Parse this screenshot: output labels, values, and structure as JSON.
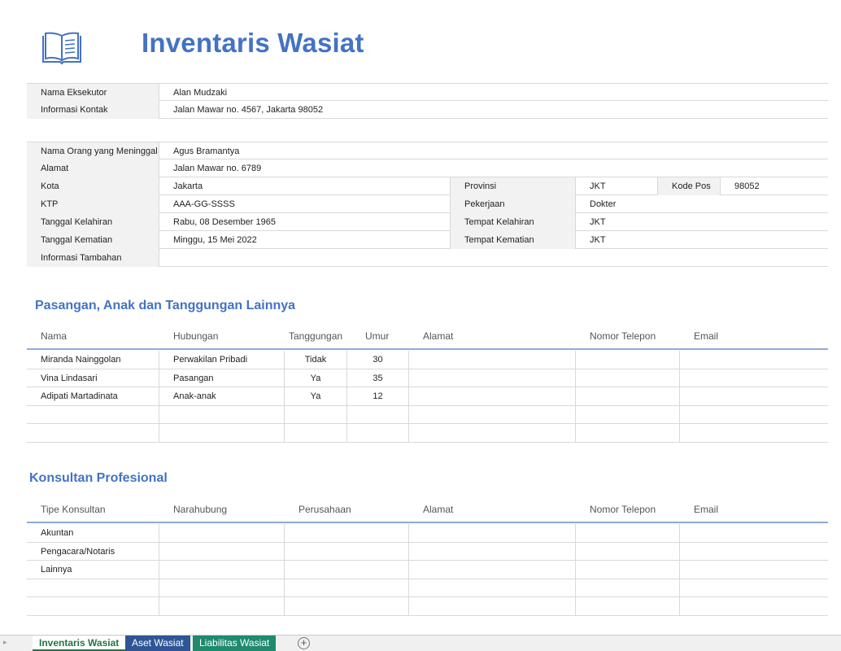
{
  "title": "Inventaris Wasiat",
  "logo_icon": "book-icon",
  "executor": {
    "name_label": "Nama Eksekutor",
    "name_value": "Alan Mudzaki",
    "contact_label": "Informasi Kontak",
    "contact_value": "Jalan Mawar no. 4567, Jakarta 98052"
  },
  "deceased": {
    "name_label": "Nama Orang yang Meninggal",
    "name_value": "Agus Bramantya",
    "address_label": "Alamat",
    "address_value": "Jalan Mawar no. 6789",
    "city_label": "Kota",
    "city_value": "Jakarta",
    "province_label": "Provinsi",
    "province_value": "JKT",
    "postal_label": "Kode Pos",
    "postal_value": "98052",
    "id_label": "KTP",
    "id_value": "AAA-GG-SSSS",
    "job_label": "Pekerjaan",
    "job_value": "Dokter",
    "birth_date_label": "Tanggal Kelahiran",
    "birth_date_value": "Rabu, 08 Desember 1965",
    "birth_place_label": "Tempat Kelahiran",
    "birth_place_value": "JKT",
    "death_date_label": "Tanggal Kematian",
    "death_date_value": "Minggu, 15 Mei 2022",
    "death_place_label": "Tempat Kematian",
    "death_place_value": "JKT",
    "extra_label": "Informasi Tambahan",
    "extra_value": ""
  },
  "dependents": {
    "title": "Pasangan, Anak dan Tanggungan Lainnya",
    "headers": [
      "Nama",
      "Hubungan",
      "Tanggungan",
      "Umur",
      "Alamat",
      "Nomor Telepon",
      "Email"
    ],
    "rows": [
      [
        "Miranda Nainggolan",
        "Perwakilan Pribadi",
        "Tidak",
        "30",
        "",
        "",
        ""
      ],
      [
        "Vina Lindasari",
        "Pasangan",
        "Ya",
        "35",
        "",
        "",
        ""
      ],
      [
        "Adipati Martadinata",
        "Anak-anak",
        "Ya",
        "12",
        "",
        "",
        ""
      ],
      [
        "",
        "",
        "",
        "",
        "",
        "",
        ""
      ],
      [
        "",
        "",
        "",
        "",
        "",
        "",
        ""
      ]
    ]
  },
  "consultants": {
    "title": "Konsultan Profesional",
    "headers": [
      "Tipe Konsultan",
      "Narahubung",
      "Perusahaan",
      "Alamat",
      "Nomor Telepon",
      "Email"
    ],
    "rows": [
      [
        "Akuntan",
        "",
        "",
        "",
        "",
        ""
      ],
      [
        "Pengacara/Notaris",
        "",
        "",
        "",
        "",
        ""
      ],
      [
        "Lainnya",
        "",
        "",
        "",
        "",
        ""
      ],
      [
        "",
        "",
        "",
        "",
        "",
        ""
      ],
      [
        "",
        "",
        "",
        "",
        "",
        ""
      ]
    ]
  },
  "tabs": {
    "tab1": "Inventaris Wasiat",
    "tab2": "Aset Wasiat",
    "tab3": "Liabilitas Wasiat",
    "add": "+"
  },
  "colors": {
    "accent": "#4472c4",
    "active_tab": "#217346",
    "tab_blue": "#2f5597",
    "tab_green": "#1f8a6e"
  }
}
